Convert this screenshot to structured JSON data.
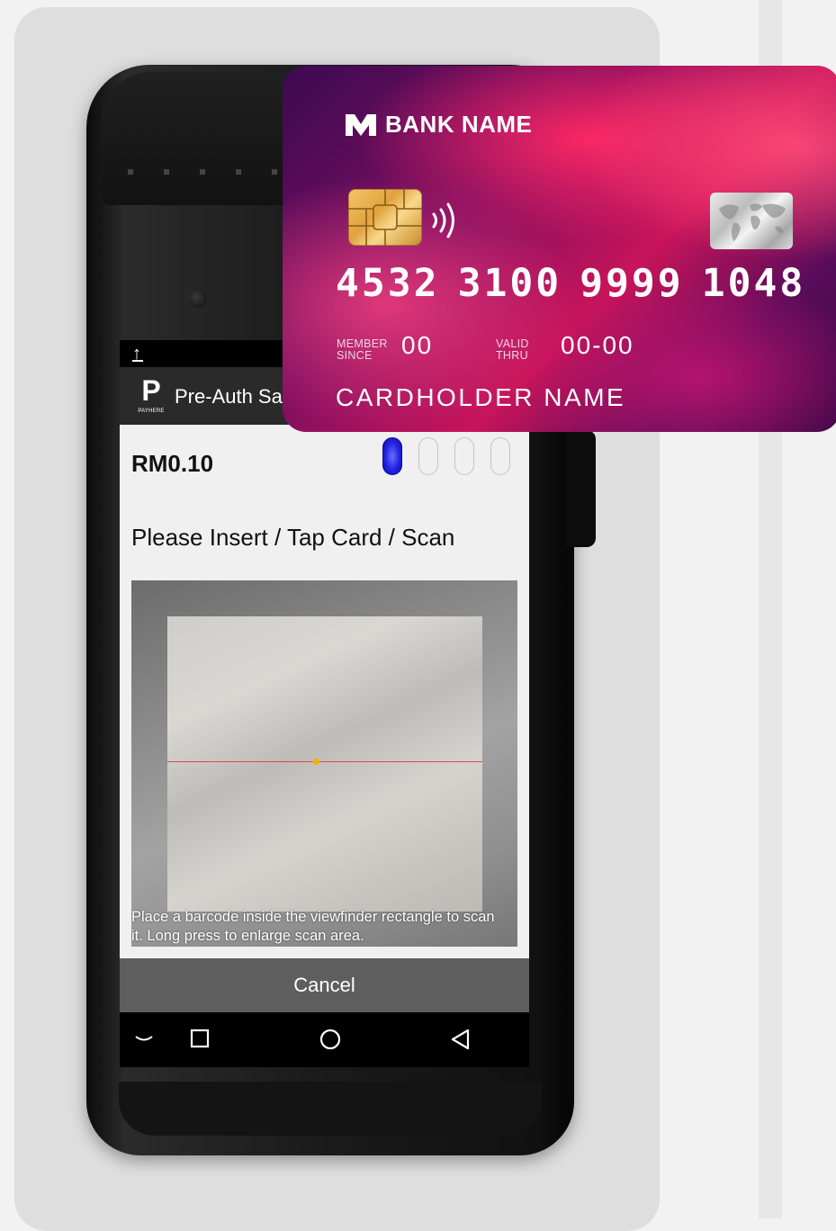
{
  "screen": {
    "app_title": "Pre-Auth Sale",
    "logo_wordmark": "PAYHERE",
    "amount": "RM0.10",
    "stage_count": 4,
    "active_stage": 1,
    "instruction": "Please Insert / Tap Card / Scan",
    "scan_hint": "Place a barcode inside the viewfinder rectangle to scan it. Long press to enlarge scan area.",
    "cancel_label": "Cancel"
  },
  "card": {
    "bank_name": "BANK NAME",
    "number_groups": [
      "4532",
      "3100",
      "9999",
      "1048"
    ],
    "member_since_label": "MEMBER SINCE",
    "member_since_value": "00",
    "valid_thru_label": "VALID THRU",
    "valid_thru_value": "00-00",
    "holder_name": "CARDHOLDER NAME"
  },
  "icons": {
    "upload": "upload-icon",
    "nav_collapse": "chevron-down-icon",
    "nav_recents": "square-icon",
    "nav_home": "circle-icon",
    "nav_back": "back-triangle-icon"
  },
  "colors": {
    "active_stage": "#2323e0",
    "cancel_bar": "#5e5e5e",
    "scan_line": "#d84c4c",
    "scan_dot": "#f2b400"
  }
}
